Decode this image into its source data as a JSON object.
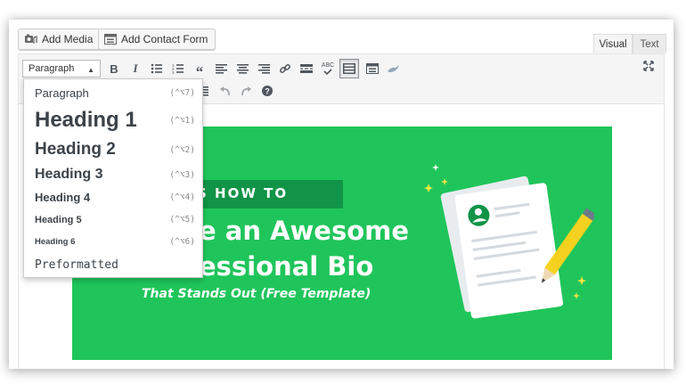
{
  "buttons": {
    "add_media": "Add Media",
    "add_contact_form": "Add Contact Form"
  },
  "tabs": {
    "visual": "Visual",
    "text": "Text"
  },
  "toolbar": {
    "format_select": "Paragraph",
    "row1_icons": [
      "bold-icon",
      "italic-icon",
      "bullet-list-icon",
      "numbered-list-icon",
      "blockquote-icon",
      "align-left-icon",
      "align-center-icon",
      "align-right-icon",
      "link-icon",
      "read-more-icon",
      "spellcheck-icon",
      "toolbar-toggle-icon",
      "form-icon",
      "wpcf7-icon"
    ],
    "row2_icons": [
      "indent-icon",
      "undo-icon",
      "redo-icon",
      "help-icon"
    ],
    "spellcheck_label": "ABC",
    "fullscreen_icon": "fullscreen-icon"
  },
  "format_menu": {
    "items": [
      {
        "label": "Paragraph",
        "shortcut": "(^⌥7)"
      },
      {
        "label": "Heading 1",
        "shortcut": "(^⌥1)"
      },
      {
        "label": "Heading 2",
        "shortcut": "(^⌥2)"
      },
      {
        "label": "Heading 3",
        "shortcut": "(^⌥3)"
      },
      {
        "label": "Heading 4",
        "shortcut": "(^⌥4)"
      },
      {
        "label": "Heading 5",
        "shortcut": "(^⌥5)"
      },
      {
        "label": "Heading 6",
        "shortcut": "(^⌥6)"
      },
      {
        "label": "Preformatted",
        "shortcut": ""
      }
    ]
  },
  "banner": {
    "howto": "S HOW TO",
    "line1": "e an Awesome",
    "line2": "essional Bio",
    "subtitle": "That Stands Out (Free Template)",
    "background_color": "#1fc55a",
    "accent_color": "#119447"
  }
}
